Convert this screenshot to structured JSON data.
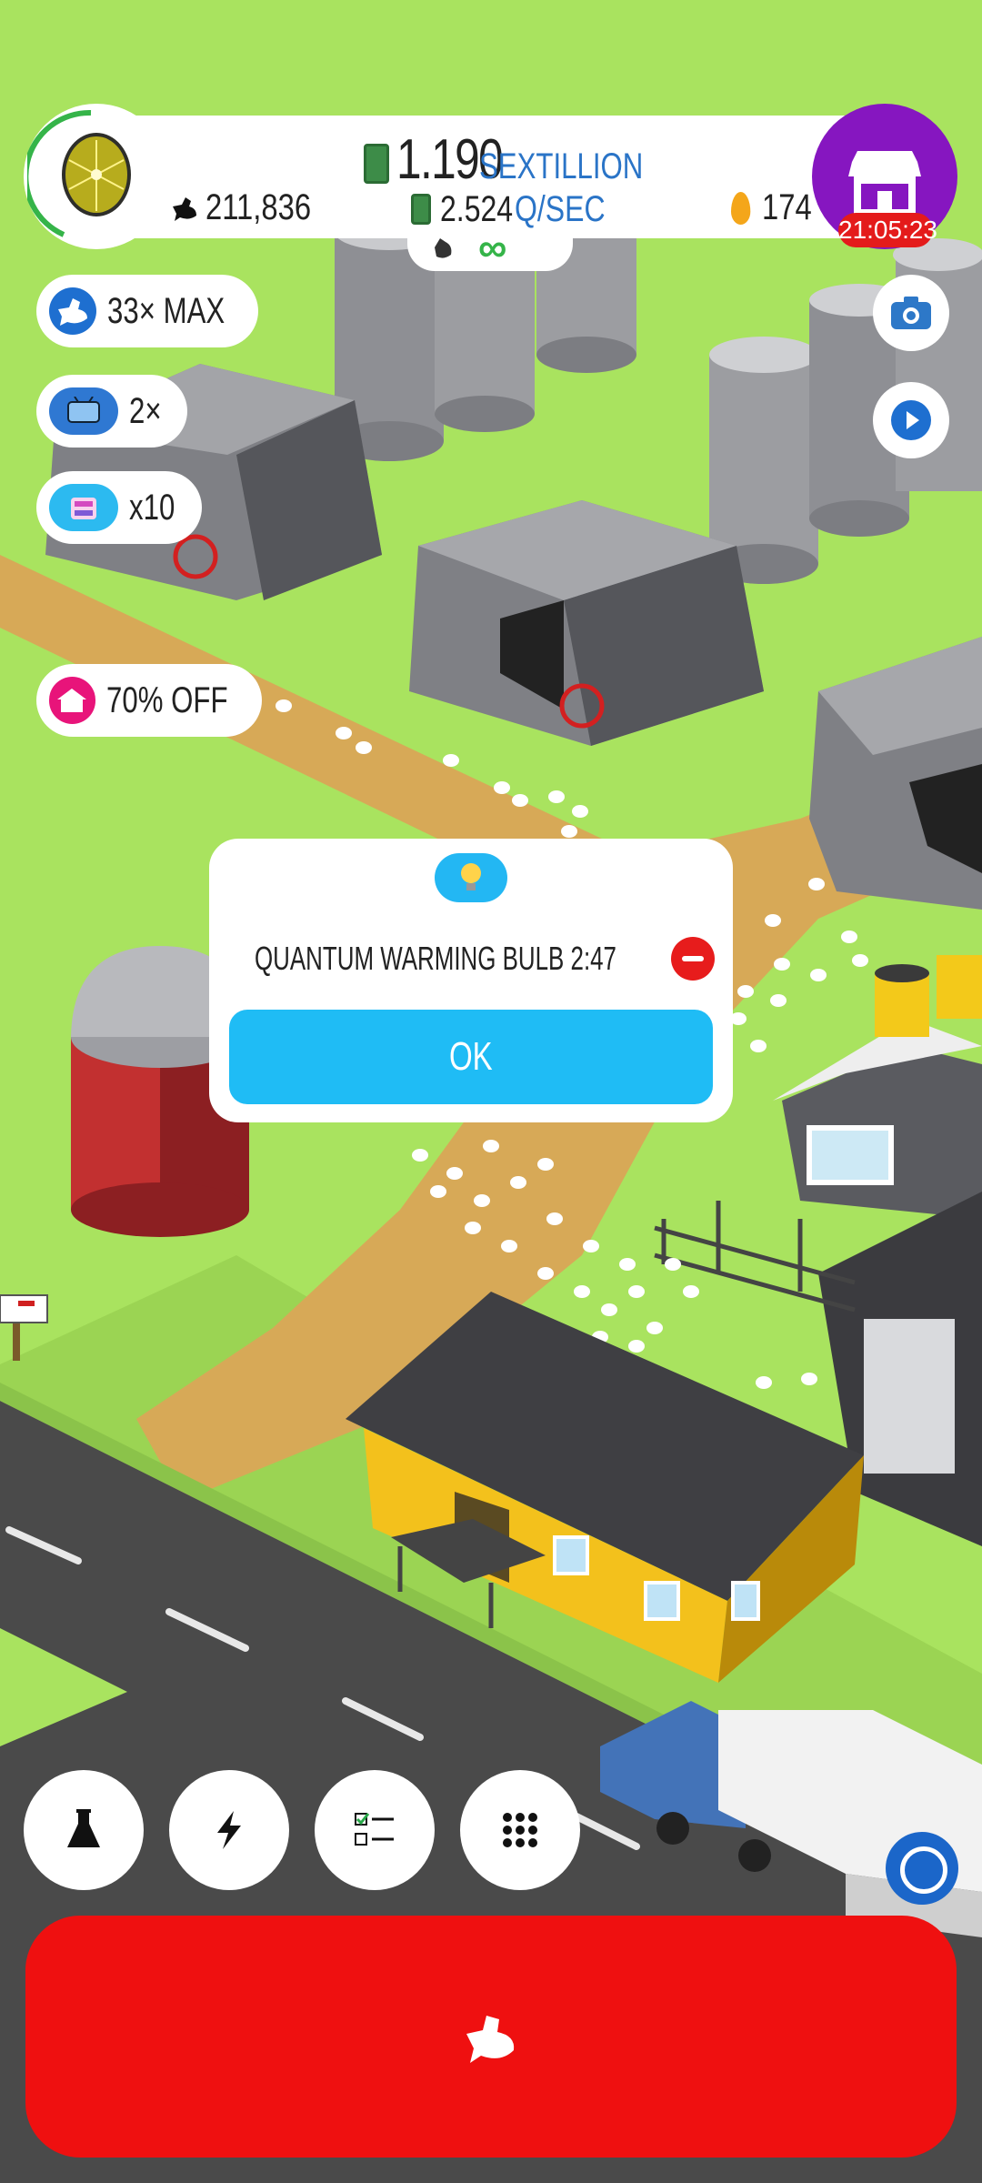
{
  "hud": {
    "money_value": "1.190",
    "money_unit": "SEXTILLION",
    "rate_value": "2.524",
    "rate_unit": "Q/SEC",
    "chicken_count": "211,836",
    "golden_eggs": "174",
    "shop_timer": "21:05:23",
    "infinity_symbol": "∞"
  },
  "boosts": [
    {
      "label": "33× MAX",
      "icon": "chicken-icon",
      "color": "#1e6fd0"
    },
    {
      "label": "2×",
      "icon": "tv-icon",
      "color": "#2f78d2"
    },
    {
      "label": "x10",
      "icon": "silo-icon",
      "color": "#2cbaf0"
    },
    {
      "label": "70% OFF",
      "icon": "home-icon",
      "color": "#e8147a"
    }
  ],
  "dialog": {
    "item_label": "QUANTUM WARMING BULB 2:47",
    "ok_label": "OK"
  },
  "toolbar": [
    {
      "icon": "flask-icon"
    },
    {
      "icon": "lightning-icon"
    },
    {
      "icon": "checklist-icon"
    },
    {
      "icon": "grid-menu-icon"
    }
  ],
  "colors": {
    "grass": "#a9e35f",
    "hatch_button": "#ef1010",
    "shop_button": "#8616c0",
    "accent_blue": "#1fbcf5",
    "unit_blue": "#2a74c7"
  }
}
